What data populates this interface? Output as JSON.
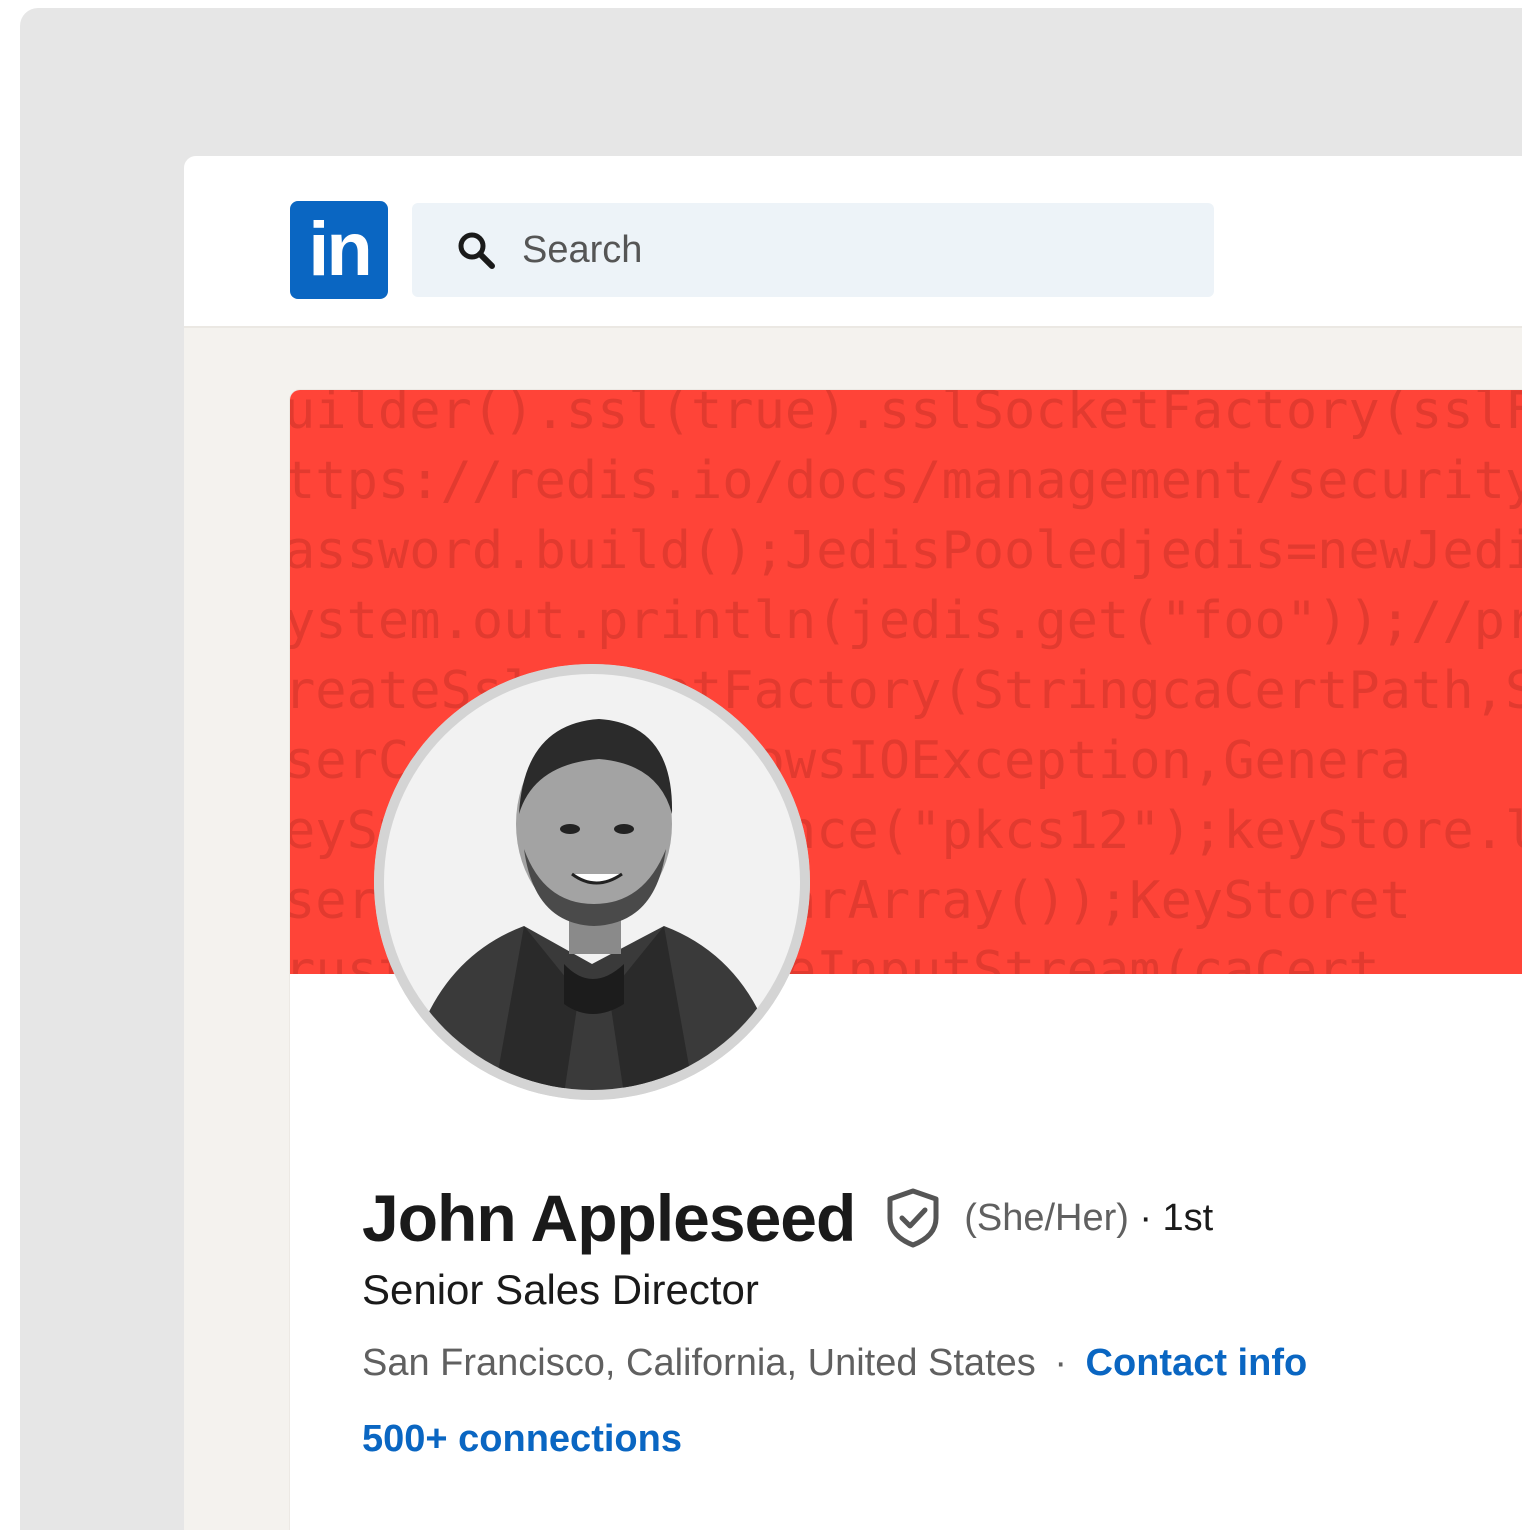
{
  "app": {
    "logo_text": "in",
    "brand_color": "#0a66c2"
  },
  "search": {
    "placeholder": "Search",
    "value": ""
  },
  "banner": {
    "color": "#ff4438",
    "code_lines": [
      "uilder().ssl(true).sslSocketFactory(sslF",
      "ttps://redis.io/docs/management/security",
      "assword.build();JedisPooledjedis=newJedi",
      "ystem.out.println(jedis.get(\"foo\"));//pr",
      "reateSslSocketFactory(StringcaCertPath,S",
      "serCertPath)throwsIOException,Genera",
      "eyStore.getInstance(\"pkcs12\");keyStore.l",
      "serPassword.toCharArray());KeyStoret",
      "rustStore=newFileInputStream(caCert"
    ]
  },
  "profile": {
    "name": "John Appleseed",
    "pronouns": "(She/Her)",
    "separator": "·",
    "degree": "1st",
    "headline": "Senior Sales Director",
    "location": "San Francisco, California, United States",
    "contact_info_label": "Contact info",
    "connections_label": "500+ connections"
  },
  "icons": {
    "search": "search-icon",
    "verified": "verified-shield-icon",
    "logo": "linkedin-logo"
  }
}
